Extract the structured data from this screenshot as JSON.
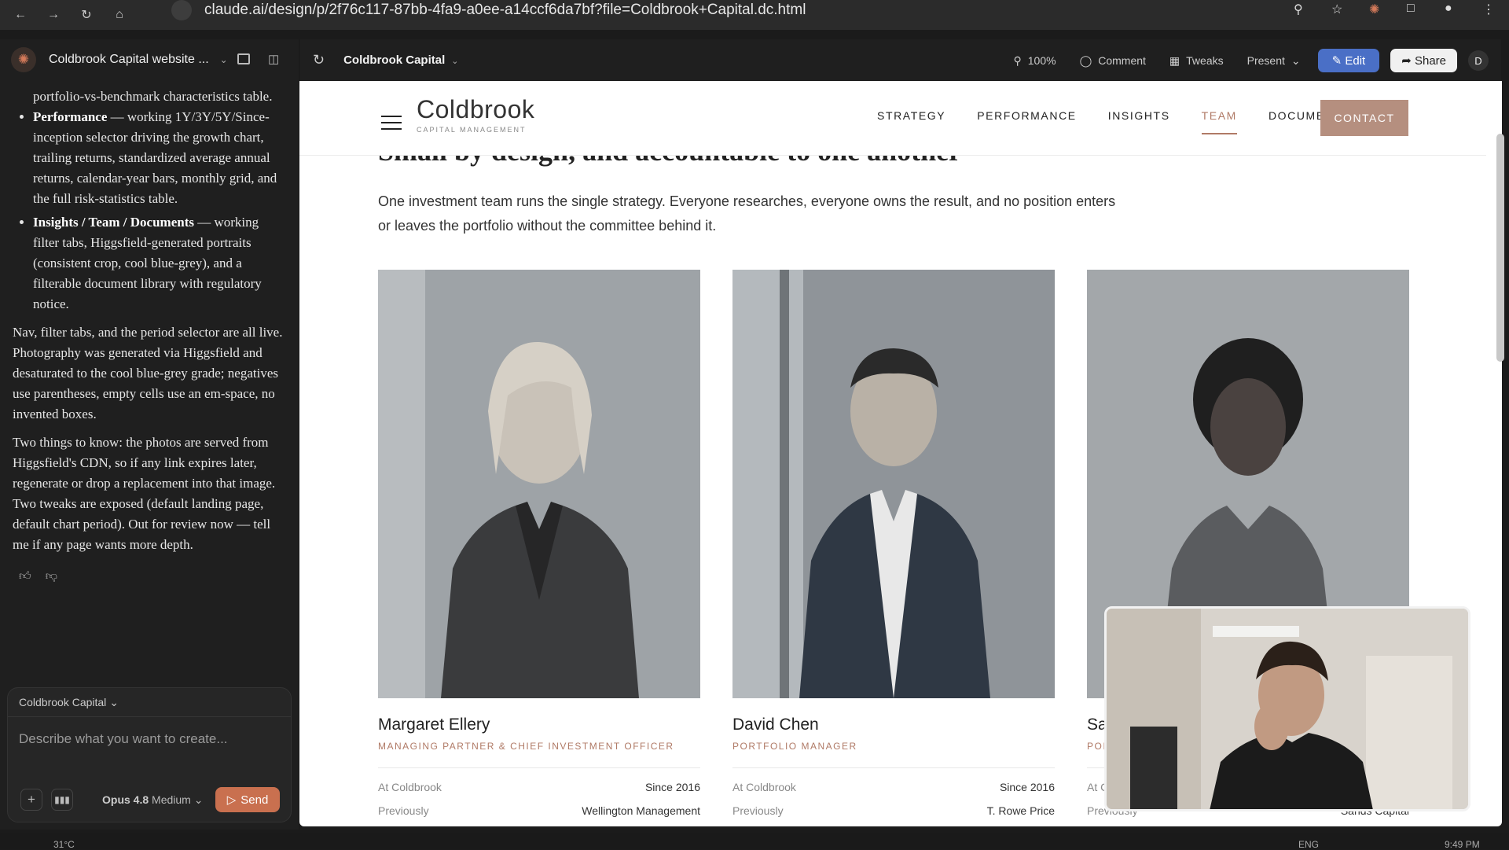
{
  "browser": {
    "url": "claude.ai/design/p/2f76c117-87bb-4fa9-a0ee-a14ccf6da7bf?file=Coldbrook+Capital.dc.html"
  },
  "sidebar": {
    "title": "Coldbrook Capital website ...",
    "message": {
      "frag": "portfolio-vs-benchmark characteristics table.",
      "bullets": [
        {
          "bold": "Performance",
          "text": " — working 1Y/3Y/5Y/Since-inception selector driving the growth chart, trailing returns, standardized average annual returns, calendar-year bars, monthly grid, and the full risk-statistics table."
        },
        {
          "bold": "Insights / Team / Documents",
          "text": " — working filter tabs, Higgsfield-generated portraits (consistent crop, cool blue-grey), and a filterable document library with regulatory notice."
        }
      ],
      "para1": "Nav, filter tabs, and the period selector are all live. Photography was generated via Higgsfield and desaturated to the cool blue-grey grade; negatives use parentheses, empty cells use an em-space, no invented boxes.",
      "para2": "Two things to know: the photos are served from Higgsfield's CDN, so if any link expires later, regenerate or drop a replacement into that image. Two tweaks are exposed (default landing page, default chart period). Out for review now — tell me if any page wants more depth."
    },
    "composer": {
      "project": "Coldbrook Capital",
      "placeholder": "Describe what you want to create...",
      "model": "Opus 4.8",
      "effort": "Medium",
      "send": "Send"
    }
  },
  "toolbar": {
    "project": "Coldbrook Capital",
    "zoom": "100%",
    "comment": "Comment",
    "tweaks": "Tweaks",
    "present": "Present",
    "edit": "Edit",
    "share": "Share",
    "avatar": "D"
  },
  "site": {
    "brand": "Coldbrook",
    "brand_sub": "CAPITAL MANAGEMENT",
    "nav": [
      "STRATEGY",
      "PERFORMANCE",
      "INSIGHTS",
      "TEAM",
      "DOCUMENTS"
    ],
    "active_nav": "TEAM",
    "contact": "CONTACT",
    "heading": "Small by design, and accountable to one another",
    "intro": "One investment team runs the single strategy. Everyone researches, everyone owns the result, and no position enters or leaves the portfolio without the committee behind it.",
    "team": [
      {
        "name": "Margaret Ellery",
        "role": "MANAGING PARTNER & CHIEF INVESTMENT OFFICER",
        "at_label": "At Coldbrook",
        "at_value": "Since 2016",
        "prev_label": "Previously",
        "prev_value": "Wellington Management"
      },
      {
        "name": "David Chen",
        "role": "PORTFOLIO MANAGER",
        "at_label": "At Coldbrook",
        "at_value": "Since 2016",
        "prev_label": "Previously",
        "prev_value": "T. Rowe Price"
      },
      {
        "name": "Sa",
        "role": "POI",
        "at_label": "At C",
        "at_value": "",
        "prev_label": "Previously",
        "prev_value": "Sands Capital"
      }
    ]
  },
  "taskbar": {
    "temp": "31°C",
    "lang": "ENG",
    "time": "9:49 PM"
  },
  "colors": {
    "accent": "#b07a66",
    "contact_bg": "#b58f7f",
    "edit_bg": "#4a6fc6",
    "send_bg": "#c9704f"
  }
}
